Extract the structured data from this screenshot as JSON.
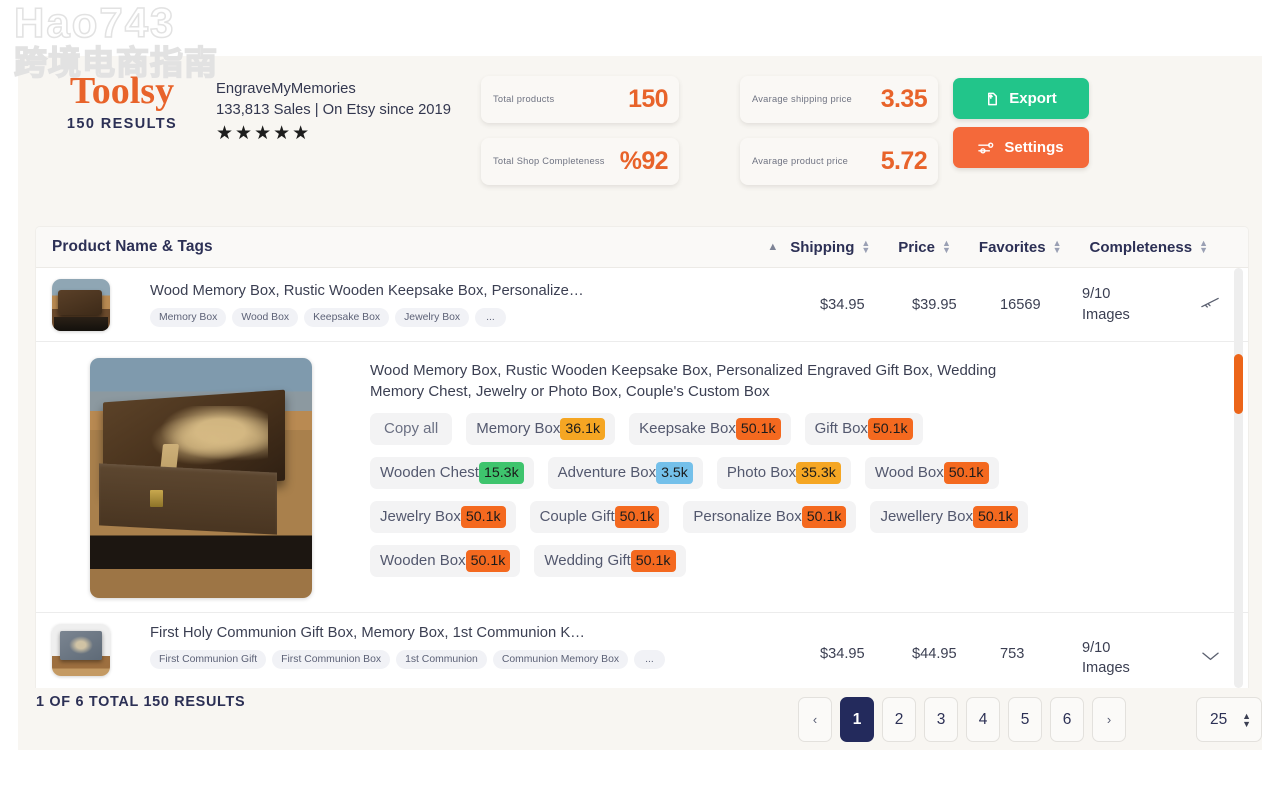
{
  "watermark": {
    "english": "Hao743",
    "chinese": "跨境电商指南"
  },
  "brand": {
    "logo": "Toolsy",
    "results_label": "150 RESULTS"
  },
  "shop": {
    "name": "EngraveMyMemories",
    "meta": "133,813 Sales | On Etsy since 2019",
    "stars": "★★★★★",
    "rating": 5
  },
  "stats": [
    {
      "label": "Total products",
      "value": "150"
    },
    {
      "label": "Total Shop Completeness",
      "value": "%92"
    },
    {
      "label": "Avarage shipping price",
      "value": "3.35"
    },
    {
      "label": "Avarage product price",
      "value": "5.72"
    }
  ],
  "actions": {
    "export_label": "Export",
    "settings_label": "Settings",
    "export_color": "#22c58a",
    "settings_color": "#f4693a"
  },
  "table": {
    "columns": {
      "name": "Product Name & Tags",
      "shipping": "Shipping",
      "price": "Price",
      "favorites": "Favorites",
      "completeness": "Completeness"
    },
    "rows": [
      {
        "title": "Wood Memory Box, Rustic Wooden Keepsake Box, Personalize…",
        "tags": [
          "Memory Box",
          "Wood Box",
          "Keepsake Box",
          "Jewelry Box",
          "..."
        ],
        "shipping": "$34.95",
        "price": "$39.95",
        "favorites": "16569",
        "completeness": "9/10 Images",
        "completeness_line1": "9/10",
        "completeness_line2": "Images",
        "expanded": false
      },
      {
        "title": "Wood Memory Box, Rustic Wooden Keepsake Box, Personalized Engraved Gift Box, Wedding Memory Chest, Jewelry or Photo Box, Couple's Custom Box",
        "copy_all_label": "Copy all",
        "expanded": true,
        "tags": [
          {
            "name": "Memory Box",
            "count": "36.1k",
            "color": "#f5a623"
          },
          {
            "name": "Keepsake Box",
            "count": "50.1k",
            "color": "#f4691f"
          },
          {
            "name": "Gift Box",
            "count": "50.1k",
            "color": "#f4691f"
          },
          {
            "name": "Wooden Chest",
            "count": "15.3k",
            "color": "#3ec46d"
          },
          {
            "name": "Adventure Box",
            "count": "3.5k",
            "color": "#74c0ea"
          },
          {
            "name": "Photo Box",
            "count": "35.3k",
            "color": "#f5a623"
          },
          {
            "name": "Wood Box",
            "count": "50.1k",
            "color": "#f4691f"
          },
          {
            "name": "Jewelry Box",
            "count": "50.1k",
            "color": "#f4691f"
          },
          {
            "name": "Couple Gift",
            "count": "50.1k",
            "color": "#f4691f"
          },
          {
            "name": "Personalize Box",
            "count": "50.1k",
            "color": "#f4691f"
          },
          {
            "name": "Jewellery Box",
            "count": "50.1k",
            "color": "#f4691f"
          },
          {
            "name": "Wooden Box",
            "count": "50.1k",
            "color": "#f4691f"
          },
          {
            "name": "Wedding Gift",
            "count": "50.1k",
            "color": "#f4691f"
          }
        ]
      },
      {
        "title": "First Holy Communion Gift Box, Memory Box, 1st Communion K…",
        "tags": [
          "First Communion Gift",
          "First Communion Box",
          "1st Communion",
          "Communion Memory Box",
          "..."
        ],
        "shipping": "$34.95",
        "price": "$44.95",
        "favorites": "753",
        "completeness": "9/10 Images",
        "completeness_line1": "9/10",
        "completeness_line2": "Images",
        "expanded": false
      }
    ]
  },
  "footer": {
    "count_text": "1 OF 6 TOTAL 150 RESULTS",
    "pagination": {
      "prev": "‹",
      "pages": [
        "1",
        "2",
        "3",
        "4",
        "5",
        "6"
      ],
      "next": "›",
      "active_page": "1"
    },
    "per_page": "25"
  }
}
